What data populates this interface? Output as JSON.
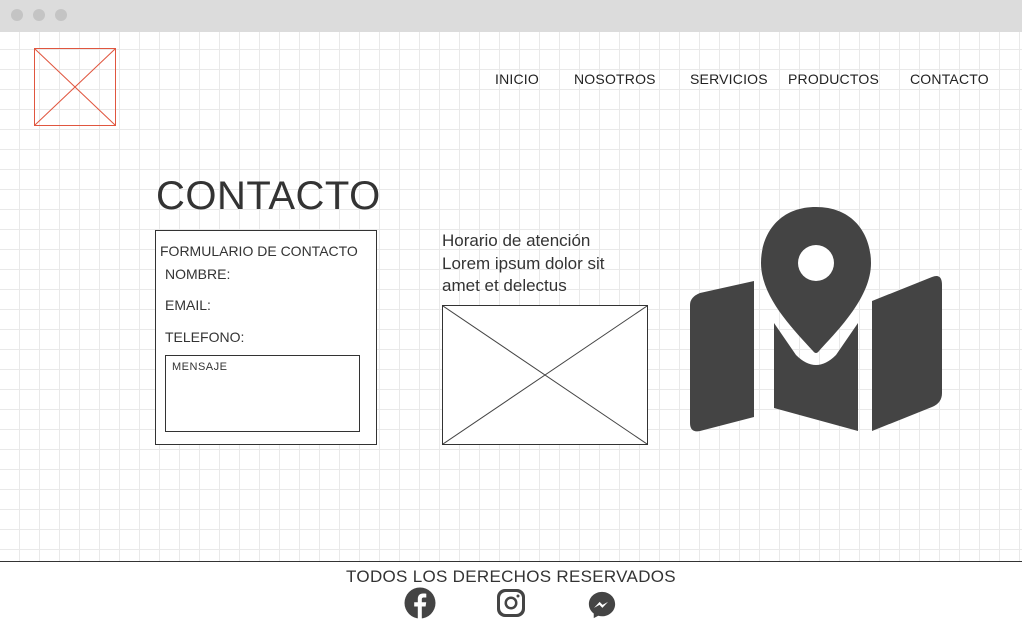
{
  "window": {
    "controls": [
      "close",
      "minimize",
      "maximize"
    ]
  },
  "header": {
    "logo_icon": "image-placeholder-icon",
    "nav": [
      {
        "label": "INICIO"
      },
      {
        "label": "NOSOTROS"
      },
      {
        "label": "SERVICIOS"
      },
      {
        "label": "PRODUCTOS"
      },
      {
        "label": "CONTACTO"
      }
    ]
  },
  "main": {
    "title": "CONTACTO",
    "form": {
      "title": "FORMULARIO DE CONTACTO",
      "fields": [
        {
          "label": "NOMBRE:"
        },
        {
          "label": "EMAIL:"
        },
        {
          "label": "TELEFONO:"
        }
      ],
      "message_label": "MENSAJE"
    },
    "info": {
      "heading": "Horario de atención",
      "body": "Lorem ipsum dolor sit amet et delectus"
    },
    "image_icon": "image-placeholder-icon",
    "map_icon": "map-location-icon"
  },
  "footer": {
    "text": "TODOS LOS DERECHOS RESERVADOS",
    "social": [
      {
        "icon": "facebook-icon"
      },
      {
        "icon": "instagram-icon"
      },
      {
        "icon": "messenger-icon"
      }
    ]
  },
  "colors": {
    "logo_border": "#e0563f",
    "icon_fill": "#444444",
    "grid": "#e9e9e9",
    "titlebar": "#dcdcdc"
  }
}
